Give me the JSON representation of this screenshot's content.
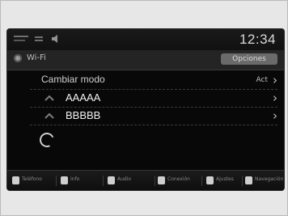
{
  "status": {
    "clock": "12:34"
  },
  "header": {
    "title": "Wi-Fi",
    "options_label": "Opciones"
  },
  "list": {
    "header_label": "Cambiar modo",
    "header_value": "Act",
    "items": [
      {
        "label": "AAAAA"
      },
      {
        "label": "BBBBB"
      }
    ]
  },
  "bottom_bar": [
    {
      "icon": "phone-icon",
      "label": "Teléfono"
    },
    {
      "icon": "info-icon",
      "label": "Info"
    },
    {
      "icon": "audio-icon",
      "label": "Audio"
    },
    {
      "icon": "device-icon",
      "label": "Conexión"
    },
    {
      "icon": "settings-icon",
      "label": "Ajustes"
    },
    {
      "icon": "nav-icon",
      "label": "Navegación"
    }
  ],
  "colors": {
    "screen_bg": "#080808",
    "text": "#f2f2f2",
    "options_button": "#6a6a6a"
  }
}
